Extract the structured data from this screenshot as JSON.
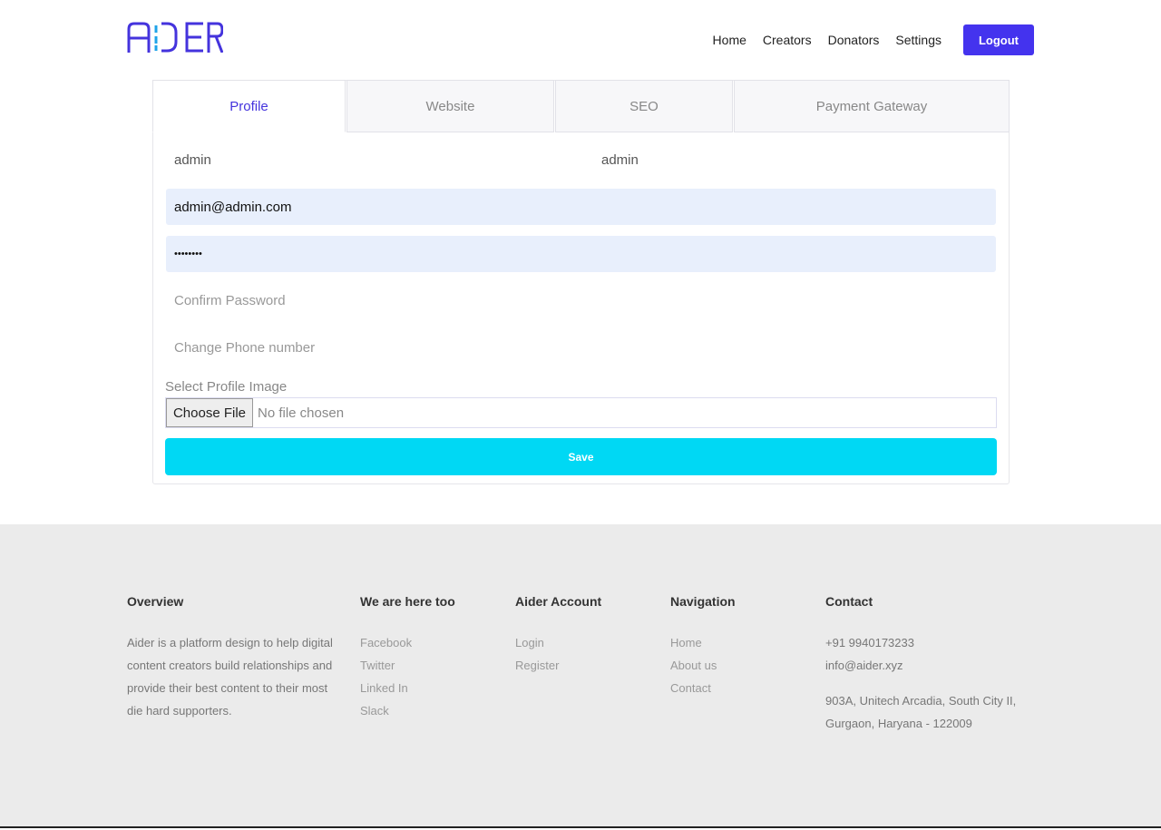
{
  "brand": {
    "logo_text": "AIDER",
    "accent": "#4433ee"
  },
  "nav": {
    "items": [
      "Home",
      "Creators",
      "Donators",
      "Settings"
    ],
    "logout": "Logout"
  },
  "tabs": [
    "Profile",
    "Website",
    "SEO",
    "Payment Gateway"
  ],
  "form": {
    "first_name": "admin",
    "last_name": "admin",
    "email": "admin@admin.com",
    "password": "••••••••",
    "confirm_placeholder": "Confirm Password",
    "phone_placeholder": "Change Phone number",
    "image_label": "Select Profile Image",
    "choose_file": "Choose File",
    "no_file": "No file chosen",
    "save": "Save"
  },
  "footer": {
    "overview": {
      "title": "Overview",
      "text": "Aider is a platform design to help digital content creators build relationships and provide their best content to their most die hard supporters."
    },
    "social": {
      "title": "We are here too",
      "links": [
        "Facebook",
        "Twitter",
        "Linked In",
        "Slack"
      ]
    },
    "account": {
      "title": "Aider Account",
      "links": [
        "Login",
        "Register"
      ]
    },
    "navigation": {
      "title": "Navigation",
      "links": [
        "Home",
        "About us",
        "Contact"
      ]
    },
    "contact": {
      "title": "Contact",
      "phone": "+91 9940173233",
      "email": "info@aider.xyz",
      "address1": "903A, Unitech Arcadia, South City II,",
      "address2": "Gurgaon, Haryana - 122009"
    }
  }
}
